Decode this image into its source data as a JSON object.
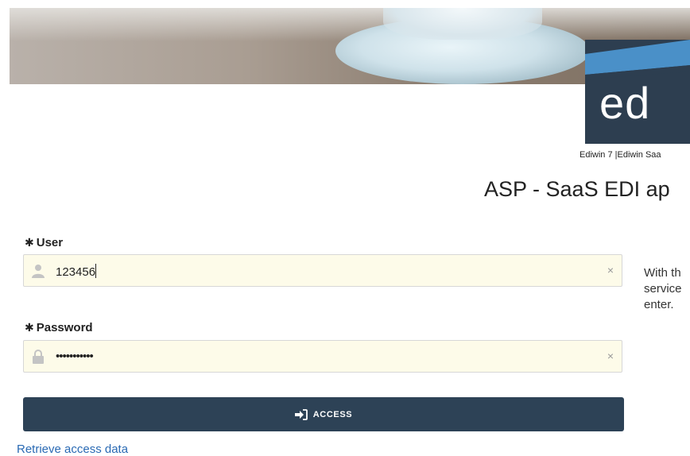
{
  "brand": {
    "logo_text": "ed",
    "product_line": "Ediwin 7 |Ediwin Saa",
    "headline": "ASP - SaaS EDI ap",
    "colors": {
      "navy": "#2d3e50",
      "accent_blue": "#4a90c8",
      "input_bg": "#fdfbe9"
    }
  },
  "form": {
    "user": {
      "required_mark": "✱",
      "label": "User",
      "icon": "user-icon",
      "value": "123456",
      "clear": "×"
    },
    "password": {
      "required_mark": "✱",
      "label": "Password",
      "icon": "lock-icon",
      "value": "•••••••••••",
      "clear": "×"
    },
    "access_button": {
      "icon": "sign-in-icon",
      "label": "ACCESS"
    },
    "retrieve_link": "Retrieve access data"
  },
  "side_text": {
    "lines": [
      "With th",
      "service",
      "enter."
    ]
  }
}
